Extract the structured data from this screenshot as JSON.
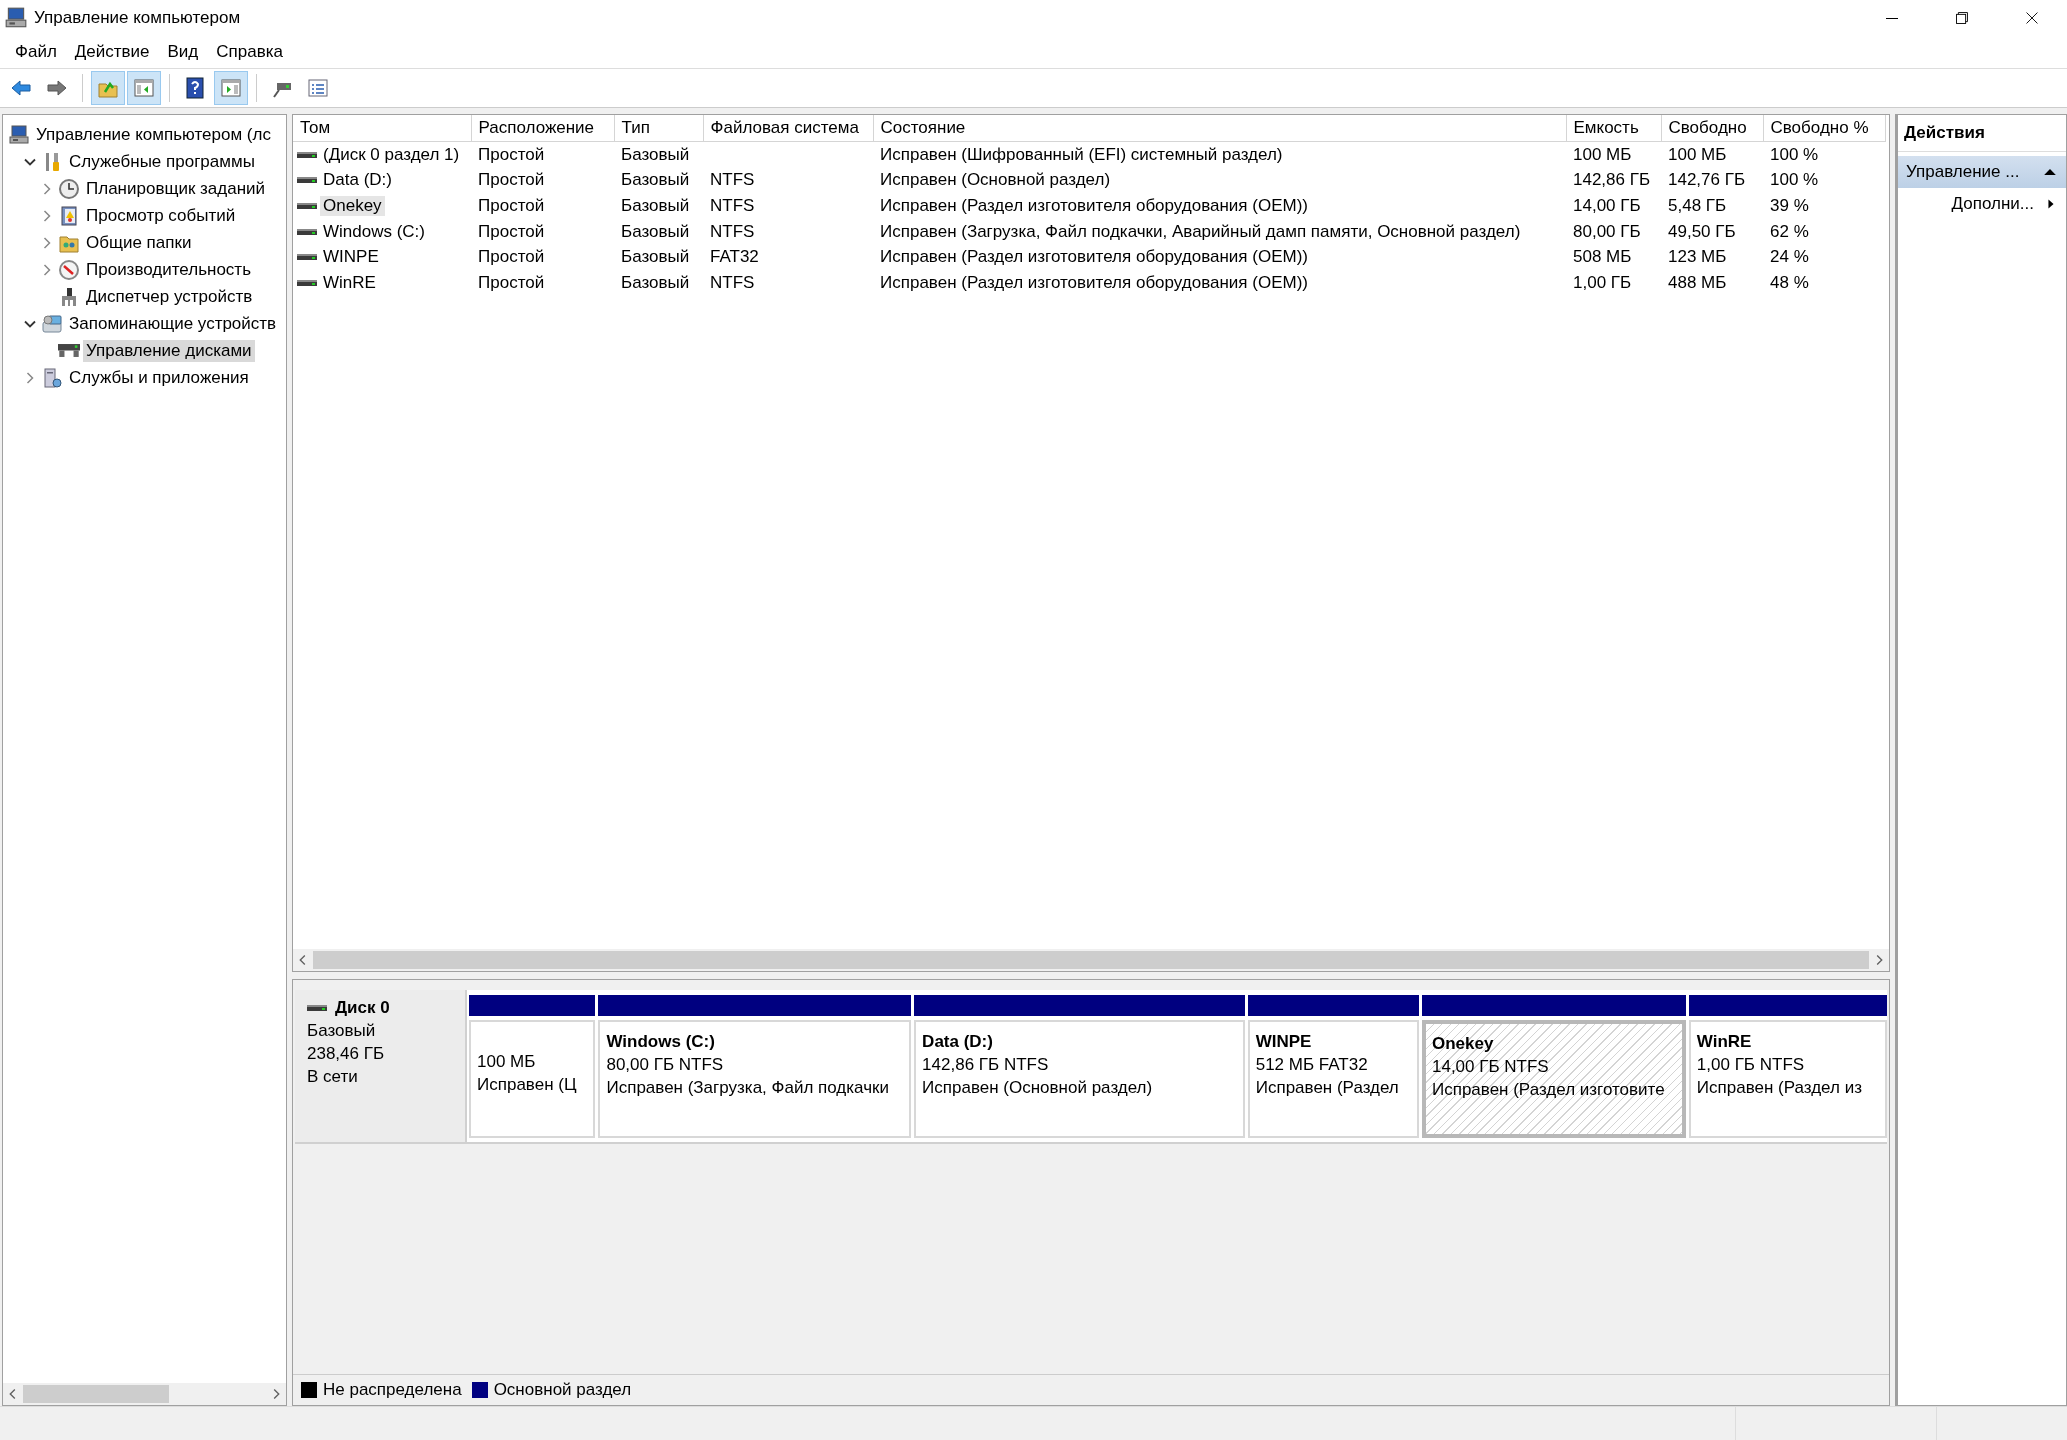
{
  "window": {
    "title": "Управление компьютером"
  },
  "menu": [
    {
      "label": "Файл"
    },
    {
      "label": "Действие"
    },
    {
      "label": "Вид"
    },
    {
      "label": "Справка"
    }
  ],
  "toolbar": [
    {
      "kind": "back",
      "pressed": false
    },
    {
      "kind": "forward",
      "pressed": false
    },
    {
      "kind": "separator"
    },
    {
      "kind": "up",
      "pressed": true
    },
    {
      "kind": "console-tree",
      "pressed": true
    },
    {
      "kind": "separator"
    },
    {
      "kind": "help",
      "pressed": false
    },
    {
      "kind": "action-pane",
      "pressed": true
    },
    {
      "kind": "separator"
    },
    {
      "kind": "connect",
      "pressed": false
    },
    {
      "kind": "properties",
      "pressed": false
    }
  ],
  "tree": [
    {
      "label": "Управление компьютером (лс",
      "kind": "computer",
      "selected": false,
      "children": [
        {
          "label": "Служебные программы",
          "kind": "tools",
          "expanded": true,
          "selected": false,
          "children": [
            {
              "label": "Планировщик заданий",
              "kind": "scheduler",
              "expanded": false,
              "selected": false
            },
            {
              "label": "Просмотр событий",
              "kind": "events",
              "expanded": false,
              "selected": false
            },
            {
              "label": "Общие папки",
              "kind": "shares",
              "expanded": false,
              "selected": false
            },
            {
              "label": "Производительность",
              "kind": "performance",
              "expanded": false,
              "selected": false
            },
            {
              "label": "Диспетчер устройств",
              "kind": "devices",
              "selected": false
            }
          ]
        },
        {
          "label": "Запоминающие устройств",
          "kind": "storage",
          "expanded": true,
          "selected": false,
          "children": [
            {
              "label": "Управление дисками",
              "kind": "disks",
              "selected": true
            }
          ]
        },
        {
          "label": "Службы и приложения",
          "kind": "services",
          "expanded": false,
          "selected": false
        }
      ]
    }
  ],
  "table": {
    "columns": [
      "Том",
      "Расположение",
      "Тип",
      "Файловая система",
      "Состояние",
      "Емкость",
      "Свободно",
      "Свободно %"
    ],
    "rows": [
      {
        "cells": [
          "(Диск 0 раздел 1)",
          "Простой",
          "Базовый",
          "",
          "Исправен (Шифрованный (EFI) системный раздел)",
          "100 МБ",
          "100 МБ",
          "100 %"
        ],
        "selected": false
      },
      {
        "cells": [
          "Data (D:)",
          "Простой",
          "Базовый",
          "NTFS",
          "Исправен (Основной раздел)",
          "142,86 ГБ",
          "142,76 ГБ",
          "100 %"
        ],
        "selected": false
      },
      {
        "cells": [
          "Onekey",
          "Простой",
          "Базовый",
          "NTFS",
          "Исправен (Раздел изготовителя оборудования (OEM))",
          "14,00 ГБ",
          "5,48 ГБ",
          "39 %"
        ],
        "selected": true
      },
      {
        "cells": [
          "Windows (C:)",
          "Простой",
          "Базовый",
          "NTFS",
          "Исправен (Загрузка, Файл подкачки, Аварийный дамп памяти, Основной раздел)",
          "80,00 ГБ",
          "49,50 ГБ",
          "62 %"
        ],
        "selected": false
      },
      {
        "cells": [
          "WINPE",
          "Простой",
          "Базовый",
          "FAT32",
          "Исправен (Раздел изготовителя оборудования (OEM))",
          "508 МБ",
          "123 МБ",
          "24 %"
        ],
        "selected": false
      },
      {
        "cells": [
          "WinRE",
          "Простой",
          "Базовый",
          "NTFS",
          "Исправен (Раздел изготовителя оборудования (OEM))",
          "1,00 ГБ",
          "488 МБ",
          "48 %"
        ],
        "selected": false
      }
    ]
  },
  "disks": [
    {
      "name": "Диск 0",
      "type": "Базовый",
      "size": "238,46 ГБ",
      "status": "В сети",
      "partitions": [
        {
          "kind": "primary",
          "size": "100 МБ",
          "status": "Исправен (Ц",
          "selected": false
        },
        {
          "kind": "primary",
          "name": "Windows  (C:)",
          "size": "80,00 ГБ NTFS",
          "status": "Исправен (Загрузка, Файл подкачки",
          "selected": false
        },
        {
          "kind": "primary",
          "name": "Data  (D:)",
          "size": "142,86 ГБ NTFS",
          "status": "Исправен (Основной раздел)",
          "selected": false
        },
        {
          "kind": "primary",
          "name": "WINPE",
          "size": "512 МБ FAT32",
          "status": "Исправен (Раздел",
          "selected": false
        },
        {
          "kind": "primary",
          "name": "Onekey",
          "size": "14,00 ГБ NTFS",
          "status": "Исправен (Раздел изготовите",
          "selected": true
        },
        {
          "kind": "primary",
          "name": "WinRE",
          "size": "1,00 ГБ NTFS",
          "status": "Исправен (Раздел из",
          "selected": false
        }
      ]
    }
  ],
  "legend": [
    {
      "label": "Не распределена",
      "color": "#000000"
    },
    {
      "label": "Основной раздел",
      "color": "#000080"
    }
  ],
  "actions": {
    "title": "Действия",
    "items": [
      {
        "kind": "group",
        "label": "Управление ...",
        "expanded": true
      },
      {
        "kind": "item",
        "label": "Дополни..."
      }
    ]
  }
}
